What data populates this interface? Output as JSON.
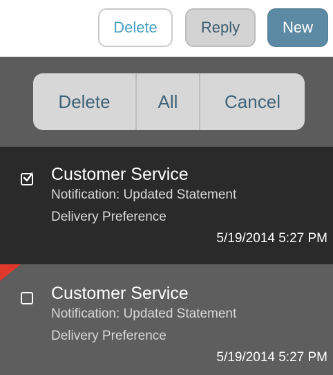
{
  "toolbar": {
    "delete_label": "Delete",
    "reply_label": "Reply",
    "new_label": "New"
  },
  "action_sheet": {
    "delete_label": "Delete",
    "all_label": "All",
    "cancel_label": "Cancel"
  },
  "messages": [
    {
      "sender": "Customer Service",
      "subject": "Notification: Updated Statement Delivery Preference",
      "timestamp": "5/19/2014 5:27 PM",
      "checked": true,
      "unread": false
    },
    {
      "sender": "Customer Service",
      "subject": "Notification: Updated Statement Delivery Preference",
      "timestamp": "5/19/2014 5:27 PM",
      "checked": false,
      "unread": true
    }
  ],
  "colors": {
    "accent_blue": "#5c8aa5",
    "unread_flag": "#e0392b",
    "selected_row": "#2a2a2a",
    "row_background": "#5e5e5e"
  }
}
